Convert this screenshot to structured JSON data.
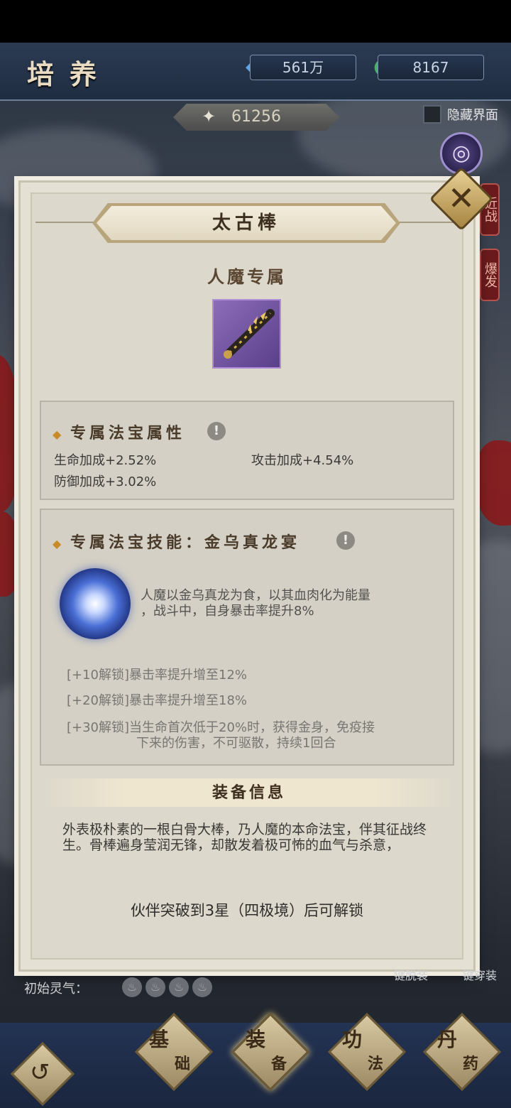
{
  "header": {
    "title": "培养",
    "currency1": "561万",
    "currency2": "8167",
    "power": "61256",
    "hide_ui_label": "隐藏界面"
  },
  "side_tags": [
    "近战",
    "爆发"
  ],
  "item": {
    "name": "太古棒",
    "exclusive": "人魔专属"
  },
  "attributes": {
    "title": "专属法宝属性",
    "stats": [
      "生命加成+2.52%",
      "攻击加成+4.54%",
      "防御加成+3.02%"
    ]
  },
  "skill": {
    "title": "专属法宝技能：金乌真龙宴",
    "desc_line1": "人魔以金乌真龙为食，以其血肉化为能量",
    "desc_line2": "，战斗中，自身暴击率提升8%",
    "unlocks": [
      {
        "line1": "[+10解锁]暴击率提升增至12%",
        "line2": ""
      },
      {
        "line1": "[+20解锁]暴击率提升增至18%",
        "line2": ""
      },
      {
        "line1": "[+30解锁]当生命首次低于20%时，获得金身，免疫接",
        "line2": "下来的伤害，不可驱散，持续1回合"
      }
    ]
  },
  "equip_info": {
    "title": "装备信息",
    "desc": "外表极朴素的一根白骨大棒，乃人魔的本命法宝，伴其征战终生。骨棒遍身莹润无锋，却散发着极可怖的血气与杀意，",
    "unlock_note": "伙伴突破到3星（四极境）后可解锁"
  },
  "lower": {
    "initial_qi": "初始灵气：",
    "text1": "键脱装",
    "text2": "键穿装"
  },
  "nav": [
    {
      "a": "基",
      "b": "础"
    },
    {
      "a": "装",
      "b": "备"
    },
    {
      "a": "功",
      "b": "法"
    },
    {
      "a": "丹",
      "b": "药"
    }
  ]
}
